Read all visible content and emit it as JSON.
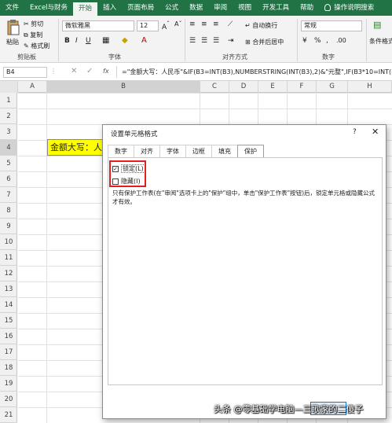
{
  "tabs": [
    "文件",
    "Excel与财务",
    "开始",
    "插入",
    "页面布局",
    "公式",
    "数据",
    "审阅",
    "视图",
    "开发工具",
    "帮助",
    "操作说明搜索"
  ],
  "active_tab": "开始",
  "ribbon": {
    "paste": "粘贴",
    "cut": "剪切",
    "copy": "复制",
    "format_painter": "格式刷",
    "clipboard": "剪贴板",
    "font_name": "微软雅黑",
    "font_size": "12",
    "font": "字体",
    "wrap_text": "自动换行",
    "merge_center": "合并后居中",
    "alignment": "对齐方式",
    "number_format": "常规",
    "number": "数字",
    "conditional": "条件格式"
  },
  "formula_bar": {
    "name_box": "B4",
    "fx": "fx",
    "formula": "=\"金额大写：人民币\"&IF(B3=INT(B3),NUMBERSTRING(INT(B3),2)&\"元整\",IF(B3*10=INT(B3*"
  },
  "columns": [
    "A",
    "B",
    "C",
    "D",
    "E",
    "F",
    "G",
    "H"
  ],
  "rows": [
    "1",
    "2",
    "3",
    "4",
    "5",
    "6",
    "7",
    "8",
    "9",
    "10",
    "11",
    "12",
    "13",
    "14",
    "15",
    "16",
    "17",
    "18",
    "19",
    "20",
    "21"
  ],
  "cell_b4": "金额大写：人民币",
  "dialog": {
    "title": "设置单元格格式",
    "help": "?",
    "close": "✕",
    "tabs": [
      "数字",
      "对齐",
      "字体",
      "边框",
      "填充",
      "保护"
    ],
    "active_tab": "保护",
    "lock_label": "锁定(L)",
    "hide_label": "隐藏(I)",
    "note": "只有保护工作表(在\"审阅\"选项卡上的\"保护\"组中，单击\"保护工作表\"按钮)后，锁定单元格或隐藏公式才有效。"
  },
  "watermark": "头条 @零基础学电脑—三歌家的二傻子"
}
